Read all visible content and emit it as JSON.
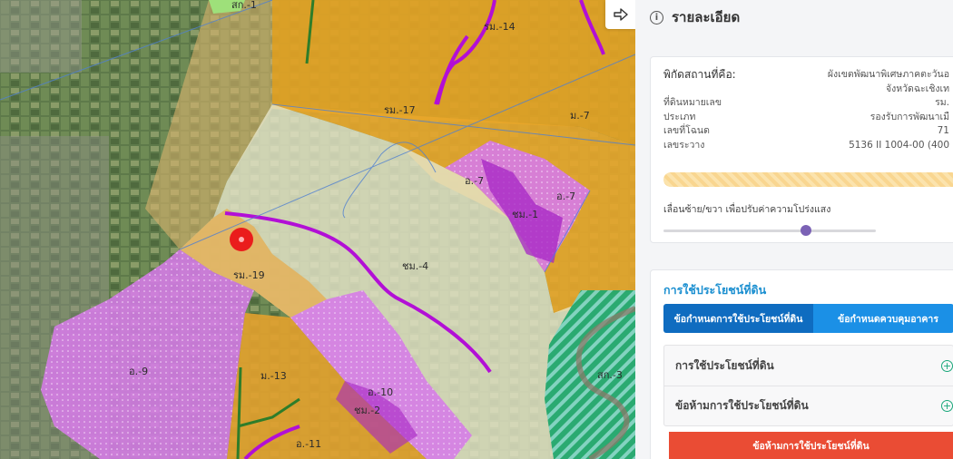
{
  "panel": {
    "title": "รายละเอียด",
    "location": {
      "label": "พิกัดสถานที่คือ:",
      "line1": "ผังเขตพัฒนาพิเศษภาคตะวันอ",
      "line2": "จังหวัดฉะเชิงเท"
    },
    "details": [
      {
        "key": "ที่ดินหมายเลข",
        "value": "รม."
      },
      {
        "key": "ประเภท",
        "value": "รองรับการพัฒนาเมื"
      },
      {
        "key": "เลขที่โฉนด",
        "value": "71"
      },
      {
        "key": "เลขระวาง",
        "value": "5136 II 1004-00 (400"
      }
    ],
    "slider": {
      "label": "เลื่อนซ้าย/ขวา เพื่อปรับค่าความโปร่งแสง",
      "value": 0.68
    },
    "land_use": {
      "title": "การใช้ประโยชน์ที่ดิน",
      "tabs": [
        "ข้อกำหนดการใช้ประโยชน์ที่ดิน",
        "ข้อกำหนดควบคุมอาคาร"
      ],
      "accordion": [
        "การใช้ประโยชน์ที่ดิน",
        "ข้อห้ามการใช้ประโยชน์ที่ดิน"
      ],
      "banner": "ข้อห้ามการใช้ประโยชน์ที่ดิน"
    },
    "icons": {
      "collapse": "arrow-right-icon",
      "info": "info-icon",
      "expand": "plus-circle-icon"
    },
    "colors": {
      "accent": "#1b8fd0",
      "tab_active": "#0f6cc0",
      "tab": "#1b90e6",
      "banner": "#ea4c34",
      "slider_thumb": "#7b62b5"
    }
  },
  "map": {
    "zones": [
      {
        "label": "สก.-1"
      },
      {
        "label": "รม.-14"
      },
      {
        "label": "รม.-17"
      },
      {
        "label": "ม.-7"
      },
      {
        "label": "อ.-7"
      },
      {
        "label": "อ.-7"
      },
      {
        "label": "ชม.-1"
      },
      {
        "label": "ชม.-4"
      },
      {
        "label": "รม.-19"
      },
      {
        "label": "อ.-9"
      },
      {
        "label": "ม.-13"
      },
      {
        "label": "อ.-10"
      },
      {
        "label": "ชม.-2"
      },
      {
        "label": "อ.-11"
      },
      {
        "label": "สก.-3"
      }
    ]
  }
}
